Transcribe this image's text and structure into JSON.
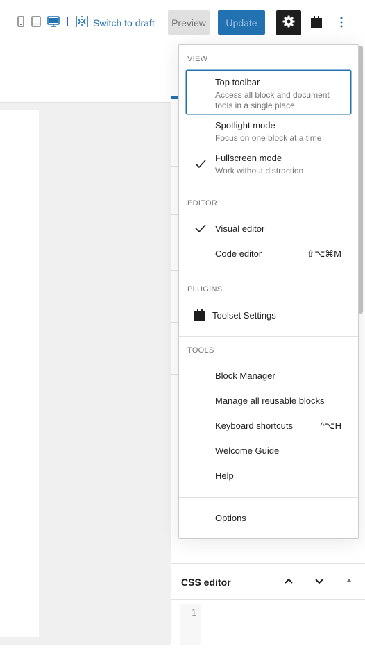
{
  "header": {
    "switch_to_draft": "Switch to draft",
    "preview": "Preview",
    "update": "Update",
    "device_icons": [
      "mobile-icon",
      "tablet-icon",
      "desktop-icon"
    ],
    "colors": {
      "accent": "#2271b1",
      "dark": "#1e1e1e"
    }
  },
  "menu": {
    "view_label": "VIEW",
    "view_items": [
      {
        "label": "Top toolbar",
        "desc": "Access all block and document tools in a single place",
        "checked": false,
        "focused": true
      },
      {
        "label": "Spotlight mode",
        "desc": "Focus on one block at a time",
        "checked": false
      },
      {
        "label": "Fullscreen mode",
        "desc": "Work without distraction",
        "checked": true
      }
    ],
    "editor_label": "EDITOR",
    "editor_items": [
      {
        "label": "Visual editor",
        "checked": true,
        "shortcut": ""
      },
      {
        "label": "Code editor",
        "checked": false,
        "shortcut": "⇧⌥⌘M"
      }
    ],
    "plugins_label": "PLUGINS",
    "plugins_items": [
      {
        "label": "Toolset Settings",
        "icon": "toolset-icon"
      }
    ],
    "tools_label": "TOOLS",
    "tools_items": [
      {
        "label": "Block Manager",
        "shortcut": ""
      },
      {
        "label": "Manage all reusable blocks",
        "shortcut": ""
      },
      {
        "label": "Keyboard shortcuts",
        "shortcut": "^⌥H"
      },
      {
        "label": "Welcome Guide",
        "shortcut": ""
      },
      {
        "label": "Help",
        "shortcut": ""
      }
    ],
    "options": "Options"
  },
  "css_editor": {
    "title": "CSS editor",
    "line_number": "1"
  }
}
